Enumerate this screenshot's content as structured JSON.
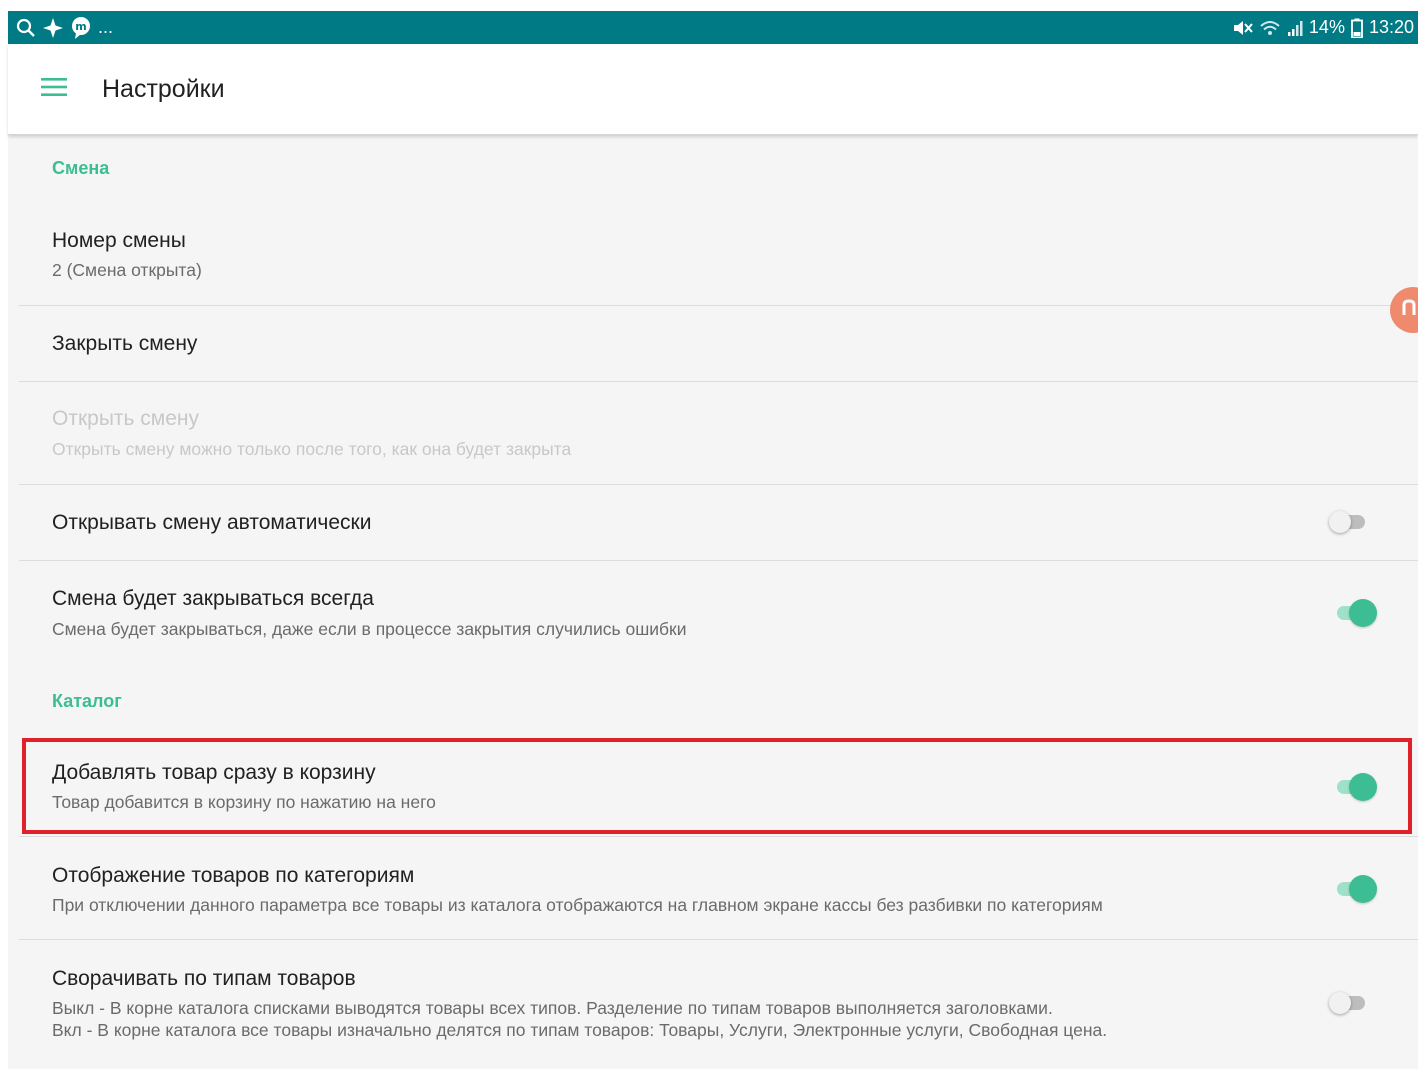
{
  "status_bar": {
    "notifications_more": "...",
    "battery": "14%",
    "time": "13:20"
  },
  "app_bar": {
    "title": "Настройки"
  },
  "sections": [
    {
      "header": "Смена",
      "items": [
        {
          "title": "Номер смены",
          "subtitle": "2 (Смена открыта)"
        },
        {
          "title": "Закрыть смену"
        },
        {
          "title": "Открыть смену",
          "subtitle": "Открыть смену можно только после того, как она будет закрыта",
          "enabled": false
        },
        {
          "title": "Открывать смену автоматически",
          "switch_on": false
        },
        {
          "title": "Смена будет закрываться всегда",
          "subtitle": "Смена будет закрываться, даже если в процессе закрытия случились ошибки",
          "switch_on": true
        }
      ]
    },
    {
      "header": "Каталог",
      "items": [
        {
          "title": "Добавлять товар сразу в корзину",
          "subtitle": "Товар добавится в корзину по нажатию на него",
          "switch_on": true,
          "highlighted": true
        },
        {
          "title": "Отображение товаров по категориям",
          "subtitle": "При отключении данного параметра все товары из каталога отображаются на главном экране кассы без разбивки по категориям",
          "switch_on": true
        },
        {
          "title": "Сворачивать по типам товаров",
          "subtitle_lines": [
            "Выкл - В корне каталога списками выводятся товары всех типов. Разделение по типам товаров выполняется заголовками.",
            "Вкл - В корне каталога все товары изначально делятся по типам товаров: Товары, Услуги, Электронные услуги, Свободная цена."
          ],
          "switch_on": false
        }
      ]
    }
  ],
  "colors": {
    "status_bar": "#007a85",
    "accent": "#3dbd94",
    "highlight_border": "#e0202a",
    "floating_button": "#f08a6e"
  },
  "icons": [
    "search-icon",
    "sparkle-icon",
    "chat-bubble-icon",
    "mute-icon",
    "wifi-icon",
    "signal-icon",
    "battery-icon",
    "hamburger-menu-icon"
  ]
}
